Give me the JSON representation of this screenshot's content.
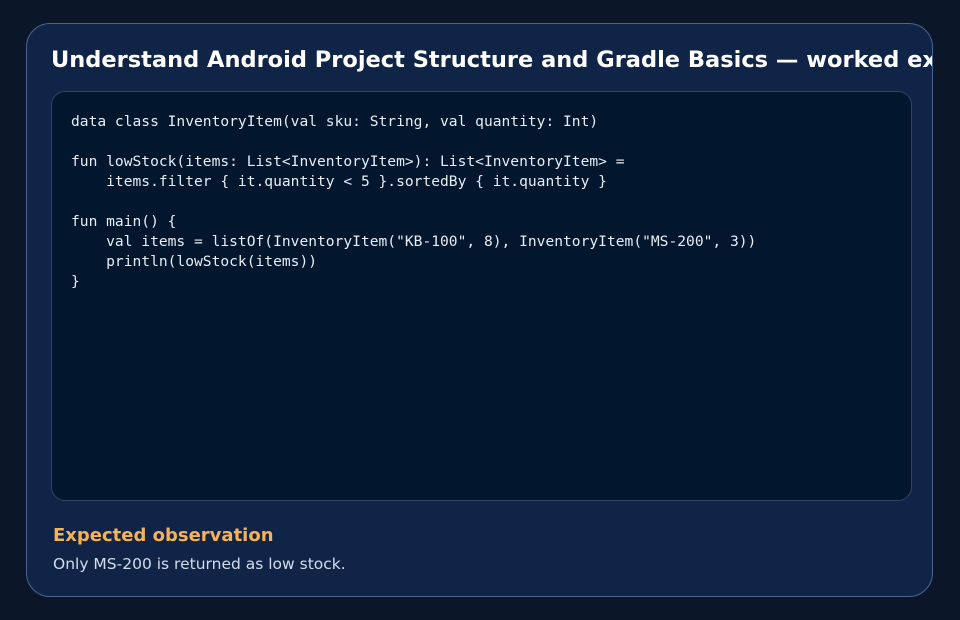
{
  "slide": {
    "title": "Understand Android Project Structure and Gradle Basics — worked example",
    "code": "data class InventoryItem(val sku: String, val quantity: Int)\n\nfun lowStock(items: List<InventoryItem>): List<InventoryItem> =\n    items.filter { it.quantity < 5 }.sortedBy { it.quantity }\n\nfun main() {\n    val items = listOf(InventoryItem(\"KB-100\", 8), InventoryItem(\"MS-200\", 3))\n    println(lowStock(items))\n}",
    "observation_heading": "Expected observation",
    "observation_text": "Only MS-200 is returned as low stock."
  },
  "colors": {
    "background": "#0b1628",
    "card": "#0f2446",
    "code_panel": "#02162e",
    "accent": "#f5b25a",
    "title": "#ffffff"
  }
}
